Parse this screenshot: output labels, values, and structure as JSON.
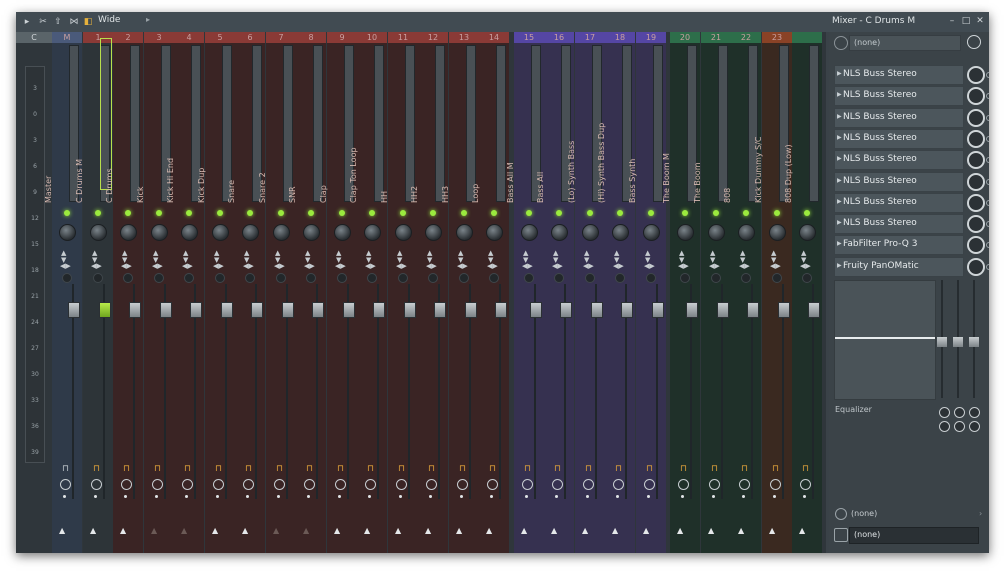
{
  "window": {
    "title": "Mixer - C Drums M",
    "preset": "Wide"
  },
  "ruler": [
    "3",
    "0",
    "3",
    "6",
    "9",
    "12",
    "15",
    "18",
    "21",
    "24",
    "27",
    "30",
    "33",
    "36",
    "39"
  ],
  "master_label": "C",
  "channels": [
    {
      "num": "M",
      "name": "Master",
      "color": "#4a5a7a",
      "bg": "#2f3a49"
    },
    {
      "num": "1",
      "name": "C Drums M",
      "color": "#8a3a36",
      "bg": "#2d3438"
    },
    {
      "num": "2",
      "name": "C Drums",
      "color": "#8a3a36",
      "bg": "#3a2424"
    },
    {
      "num": "3",
      "name": "Kick",
      "color": "#8a3a36",
      "bg": "#3a2424"
    },
    {
      "num": "4",
      "name": "Kick Hi End",
      "color": "#8a3a36",
      "bg": "#3a2424"
    },
    {
      "num": "5",
      "name": "Kick Dup",
      "color": "#8a3a36",
      "bg": "#3a2424"
    },
    {
      "num": "6",
      "name": "Snare",
      "color": "#8a3a36",
      "bg": "#3a2424"
    },
    {
      "num": "7",
      "name": "Snare 2",
      "color": "#8a3a36",
      "bg": "#3a2424"
    },
    {
      "num": "8",
      "name": "SNR",
      "color": "#8a3a36",
      "bg": "#3a2424"
    },
    {
      "num": "9",
      "name": "Clap",
      "color": "#8a3a36",
      "bg": "#3a2424"
    },
    {
      "num": "10",
      "name": "Clap Ton Loop",
      "color": "#8a3a36",
      "bg": "#3a2424"
    },
    {
      "num": "11",
      "name": "HH",
      "color": "#8a3a36",
      "bg": "#3a2424"
    },
    {
      "num": "12",
      "name": "HH2",
      "color": "#8a3a36",
      "bg": "#3a2424"
    },
    {
      "num": "13",
      "name": "HH3",
      "color": "#8a3a36",
      "bg": "#3a2424"
    },
    {
      "num": "14",
      "name": "Loop",
      "color": "#8a3a36",
      "bg": "#3a2424"
    },
    {
      "num": "15",
      "name": "Bass All M",
      "color": "#5546a4",
      "bg": "#363150"
    },
    {
      "num": "16",
      "name": "Bass All",
      "color": "#5546a4",
      "bg": "#363150"
    },
    {
      "num": "17",
      "name": "(Lo) Synth Bass",
      "color": "#5546a4",
      "bg": "#363150"
    },
    {
      "num": "18",
      "name": "(Hi) Synth Bass Dup",
      "color": "#5546a4",
      "bg": "#363150"
    },
    {
      "num": "19",
      "name": "Bass Synth",
      "color": "#5546a4",
      "bg": "#363150"
    },
    {
      "num": "20",
      "name": "The Boom M",
      "color": "#2d6e4a",
      "bg": "#1f3029"
    },
    {
      "num": "21",
      "name": "The Boom",
      "color": "#2d6e4a",
      "bg": "#1f3029"
    },
    {
      "num": "22",
      "name": "808",
      "color": "#2d6e4a",
      "bg": "#1f3029"
    },
    {
      "num": "23",
      "name": "Kick Dummy S/C",
      "color": "#8a4226",
      "bg": "#3a2920"
    },
    {
      "num": "",
      "name": "808 Dup (Low)",
      "color": "#2d6e4a",
      "bg": "#1f3029"
    }
  ],
  "rightpanel": {
    "input": "(none)",
    "fx_slots": [
      "NLS Buss Stereo",
      "NLS Buss Stereo",
      "NLS Buss Stereo",
      "NLS Buss Stereo",
      "NLS Buss Stereo",
      "NLS Buss Stereo",
      "NLS Buss Stereo",
      "NLS Buss Stereo",
      "FabFilter Pro-Q 3",
      "Fruity PanOMatic"
    ],
    "eq_label": "Equalizer",
    "sidechain": "(none)",
    "output": "(none)"
  },
  "colors": {
    "accent": "#9bea3e",
    "selection": "#b8e04c"
  }
}
